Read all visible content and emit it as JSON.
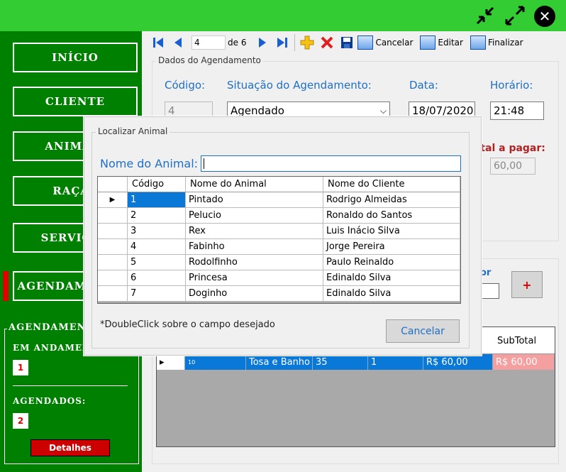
{
  "topbar": {
    "minimize_icon": "arrows-in-icon",
    "maximize_icon": "arrows-out-icon",
    "close_icon": "close-icon",
    "close_glyph": "✕"
  },
  "sidebar": {
    "items": [
      {
        "label": "INÍCIO"
      },
      {
        "label": "CLIENTE"
      },
      {
        "label": "ANIMAIS"
      },
      {
        "label": "RAÇAS"
      },
      {
        "label": "SERVIÇOS"
      },
      {
        "label": "AGENDAMENTOS"
      }
    ],
    "group_title": "AGENDAMENTOS",
    "em_andamento_label": "EM ANDAMENTO:",
    "em_andamento_count": "1",
    "agendados_label": "AGENDADOS:",
    "agendados_count": "2",
    "detalhes_label": "Detalhes"
  },
  "toolbar": {
    "position": "4",
    "of_label": "de 6",
    "cancelar": "Cancelar",
    "editar": "Editar",
    "finalizar": "Finalizar"
  },
  "form": {
    "legend": "Dados do Agendamento",
    "codigo_label": "Código:",
    "codigo_value": "4",
    "situacao_label": "Situação do Agendamento:",
    "situacao_value": "Agendado",
    "data_label": "Data:",
    "data_value": "18/07/2020",
    "horario_label": "Horário:",
    "horario_value": "21:48",
    "total_label": "Total a pagar:",
    "total_value": "60,00"
  },
  "services_grid": {
    "header_subtotal": "SubTotal",
    "row": {
      "id": "10",
      "servico": "Tosa e Banho",
      "valor": "35",
      "qtd": "1",
      "preco": "R$ 60,00",
      "subtotal": "R$ 60,00"
    },
    "add_label": "+",
    "partial_label": "or"
  },
  "dialog": {
    "legend": "Localizar Animal",
    "search_label": "Nome do Animal:",
    "search_value": "",
    "columns": [
      "Código",
      "Nome do Animal",
      "Nome do Cliente"
    ],
    "rows": [
      {
        "codigo": "1",
        "nome": "Pintado",
        "cliente": "Rodrigo Almeidas"
      },
      {
        "codigo": "2",
        "nome": "Pelucio",
        "cliente": "Ronaldo do Santos"
      },
      {
        "codigo": "3",
        "nome": "Rex",
        "cliente": "Luis Inácio Silva"
      },
      {
        "codigo": "4",
        "nome": "Fabinho",
        "cliente": "Jorge Pereira"
      },
      {
        "codigo": "5",
        "nome": "Rodolfinho",
        "cliente": "Paulo Reinaldo"
      },
      {
        "codigo": "6",
        "nome": "Princesa",
        "cliente": "Edinaldo Silva"
      },
      {
        "codigo": "7",
        "nome": "Doginho",
        "cliente": "Edinaldo Silva"
      }
    ],
    "hint": "*DoubleClick sobre o campo desejado",
    "cancel_label": "Cancelar"
  },
  "colors": {
    "sidebar": "#008000",
    "topbar": "#33cc33",
    "accent_blue": "#1f6fc6",
    "selection": "#0a78d7",
    "alert_red": "#e00000"
  }
}
